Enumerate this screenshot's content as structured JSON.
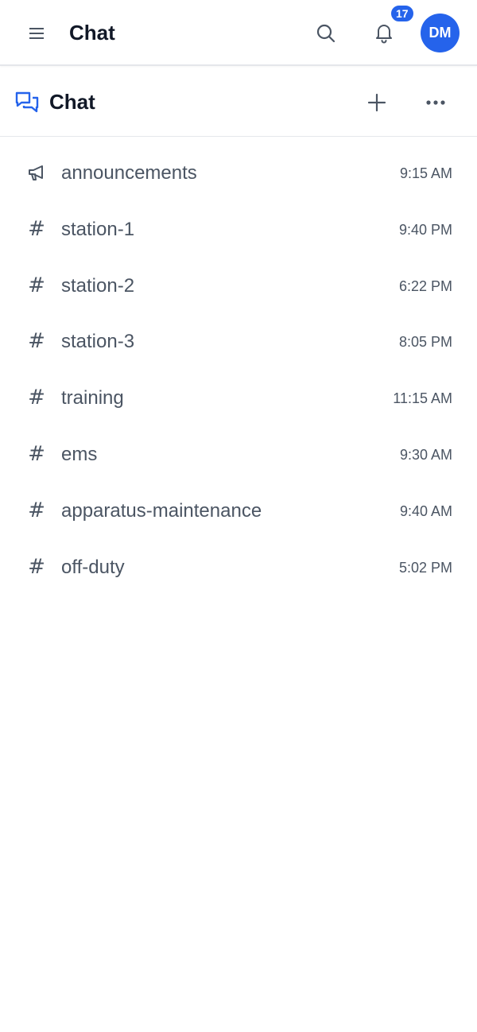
{
  "header": {
    "title": "Chat",
    "notification_count": "17",
    "avatar_initials": "DM",
    "menu_icon": "hamburger-menu-icon",
    "search_icon": "search-icon",
    "bell_icon": "bell-icon"
  },
  "section": {
    "title": "Chat",
    "icon": "chat-bubbles-icon",
    "add_icon": "plus-icon",
    "more_icon": "more-horizontal-icon"
  },
  "channels": [
    {
      "name": "announcements",
      "time": "9:15 AM",
      "icon": "megaphone-icon"
    },
    {
      "name": "station-1",
      "time": "9:40 PM",
      "icon": "hash-icon"
    },
    {
      "name": "station-2",
      "time": "6:22 PM",
      "icon": "hash-icon"
    },
    {
      "name": "station-3",
      "time": "8:05 PM",
      "icon": "hash-icon"
    },
    {
      "name": "training",
      "time": "11:15 AM",
      "icon": "hash-icon"
    },
    {
      "name": "ems",
      "time": "9:30 AM",
      "icon": "hash-icon"
    },
    {
      "name": "apparatus-maintenance",
      "time": "9:40 AM",
      "icon": "hash-icon"
    },
    {
      "name": "off-duty",
      "time": "5:02 PM",
      "icon": "hash-icon"
    }
  ],
  "colors": {
    "accent": "#2563eb",
    "text_primary": "#111827",
    "text_secondary": "#4b5563",
    "divider": "#e5e7eb"
  }
}
